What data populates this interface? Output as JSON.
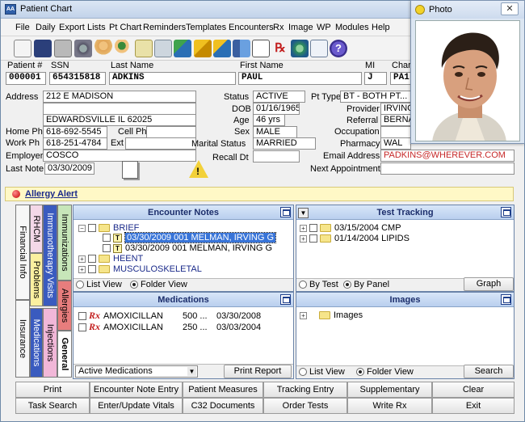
{
  "window": {
    "title": "Patient Chart"
  },
  "menu": [
    "File",
    "Daily",
    "Export",
    "Lists",
    "Pt Chart",
    "Reminders",
    "Templates",
    "Encounters",
    "Rx",
    "Image",
    "WP",
    "Modules",
    "Help"
  ],
  "patient": {
    "labels": {
      "patient_no": "Patient #",
      "ssn": "SSN",
      "last_name": "Last Name",
      "first_name": "First Name",
      "mi": "MI",
      "chart": "Chart"
    },
    "patient_no": "000001",
    "ssn": "654315818",
    "last_name": "ADKINS",
    "first_name": "PAUL",
    "mi": "J",
    "chart": "PA1"
  },
  "address": {
    "labels": {
      "address": "Address",
      "home_ph": "Home Ph",
      "cell_ph": "Cell Ph",
      "work_ph": "Work Ph",
      "ext": "Ext",
      "employer": "Employer",
      "last_note": "Last Note"
    },
    "line1": "212 E MADISON",
    "line2": "",
    "city_state_zip": "EDWARDSVILLE  IL  62025",
    "home_ph": "618-692-5545",
    "cell_ph": "",
    "work_ph": "618-251-4784",
    "ext": "",
    "employer": "COSCO",
    "last_note": "03/30/2009"
  },
  "demographics": {
    "labels": {
      "status": "Status",
      "dob": "DOB",
      "age": "Age",
      "sex": "Sex",
      "marital": "Marital Status",
      "recall": "Recall Dt"
    },
    "status": "ACTIVE",
    "dob": "01/16/1965",
    "age": "46 yrs",
    "sex": "MALE",
    "marital": "MARRIED",
    "recall": ""
  },
  "other": {
    "labels": {
      "pt_type": "Pt Type",
      "provider": "Provider",
      "referral": "Referral",
      "occupation": "Occupation",
      "pharmacy": "Pharmacy",
      "email": "Email Address",
      "next_appt": "Next Appointment"
    },
    "pt_type": "BT - BOTH PT...",
    "provider": "IRVING",
    "referral": "BERNAR",
    "occupation": "",
    "pharmacy": "WAL",
    "email": "PADKINS@WHEREVER.COM",
    "next_appt": ""
  },
  "photo": {
    "title": "Photo"
  },
  "allergy": {
    "label": "Allergy Alert"
  },
  "tabs": {
    "col1": [
      "Financial Info",
      "Insurance"
    ],
    "col2": [
      "RHCM",
      "Problems",
      "Medications"
    ],
    "col3": [
      "Immunotherapy Visits",
      "Injections"
    ],
    "col4": [
      "Immunizations",
      "Allergies",
      "General"
    ]
  },
  "encounter_notes": {
    "title": "Encounter Notes",
    "items": [
      {
        "label": "BRIEF",
        "level": 0
      },
      {
        "label": "03/30/2009  001 MELMAN, IRVING G",
        "level": 1,
        "selected": true
      },
      {
        "label": "03/30/2009  001 MELMAN, IRVING G",
        "level": 1
      },
      {
        "label": "HEENT",
        "level": 0
      },
      {
        "label": "MUSCULOSKELETAL",
        "level": 0
      }
    ],
    "view_list": "List View",
    "view_folder": "Folder View"
  },
  "test_tracking": {
    "title": "Test Tracking",
    "items": [
      "03/15/2004  CMP",
      "01/14/2004  LIPIDS"
    ],
    "by_test": "By Test",
    "by_panel": "By Panel",
    "graph": "Graph"
  },
  "medications": {
    "title": "Medications",
    "rows": [
      {
        "name": "AMOXICILLAN",
        "dose": "500 ...",
        "date": "03/30/2008"
      },
      {
        "name": "AMOXICILLAN",
        "dose": "250 ...",
        "date": "03/03/2004"
      }
    ],
    "filter": "Active Medications",
    "print_report": "Print Report"
  },
  "images": {
    "title": "Images",
    "items": [
      "Images"
    ],
    "view_list": "List View",
    "view_folder": "Folder View",
    "search": "Search"
  },
  "bottom_buttons": [
    [
      "Print",
      "Encounter Note Entry",
      "Patient Measures",
      "Tracking Entry",
      "Supplementary",
      "Clear"
    ],
    [
      "Task Search",
      "Enter/Update Vitals",
      "C32 Documents",
      "Order Tests",
      "Write Rx",
      "Exit"
    ]
  ]
}
